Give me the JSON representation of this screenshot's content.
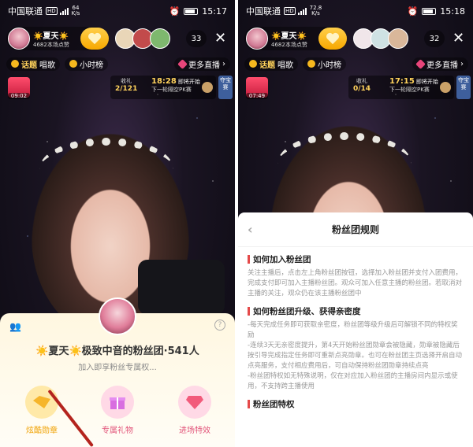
{
  "left": {
    "status": {
      "carrier": "中国联通",
      "speed_value": "64",
      "speed_unit": "K/s",
      "time": "15:17"
    },
    "host": {
      "name": "☀️夏天☀️",
      "likes": "4682本场点赞"
    },
    "viewer_count": "33",
    "tags": {
      "topic": "话题",
      "topic_sub": "唱歌",
      "hourly": "小时榜",
      "more_live": "更多直播"
    },
    "gift_timer": "09:02",
    "pk": {
      "gift_label": "收礼",
      "progress": "2/121",
      "time": "18:28",
      "time_suffix": "即将开始",
      "next": "下一轮隔空PK赛"
    },
    "treasure": "夺宝赛",
    "fan_club": {
      "title": "☀️夏天☀️极致中音的粉丝团·541人",
      "subtitle": "加入即享粉丝专属权...",
      "perks": [
        {
          "label": "炫酷勋章",
          "color": "#f0a100",
          "icon": "medal-icon",
          "bg": "#ffe9a8"
        },
        {
          "label": "专属礼物",
          "color": "#e2547a",
          "icon": "gift-icon",
          "bg": "#ffd9e6"
        },
        {
          "label": "进场特效",
          "color": "#e2547a",
          "icon": "diamond-icon",
          "bg": "#ffd9e6"
        }
      ]
    }
  },
  "right": {
    "status": {
      "carrier": "中国联通",
      "speed_value": "72.8",
      "speed_unit": "K/s",
      "time": "15:18"
    },
    "host": {
      "name": "☀️夏天☀️",
      "likes": "4682本场点赞"
    },
    "viewer_count": "32",
    "tags": {
      "topic": "话题",
      "topic_sub": "唱歌",
      "hourly": "小时榜",
      "more_live": "更多直播"
    },
    "gift_timer": "07:49",
    "pk": {
      "gift_label": "收礼",
      "progress": "0/14",
      "time": "17:15",
      "time_suffix": "即将开始",
      "next": "下一轮隔空PK赛"
    },
    "treasure": "夺宝赛",
    "rules": {
      "title": "粉丝团规则",
      "sections": [
        {
          "heading": "如何加入粉丝团",
          "body": "关注主播后，点击左上角粉丝团按钮，选择加入粉丝团并支付入团费用，完成支付即可加入主播粉丝团。观众可加入任意主播的粉丝团。若取消对主播的关注，观众仍在该主播粉丝团中"
        },
        {
          "heading": "如何粉丝团升级、获得亲密度",
          "body": "-每天完成任务即可获取亲密度，粉丝团等级升级后可解锁不同的特权奖励\n-连续3天无亲密度提升，第4天开始粉丝团勋章会被隐藏，勋章被隐藏后按引导完成指定任务即可重新点亮勋章。也可在粉丝团主页选择开启自动点亮服务，支付相应费用后，可自动保持粉丝团勋章持续点亮\n-粉丝团特权如无特殊说明，仅在对应加入粉丝团的主播房间内显示或使用，不支持跨主播使用"
        },
        {
          "heading": "粉丝团特权",
          "body": ""
        }
      ]
    }
  }
}
